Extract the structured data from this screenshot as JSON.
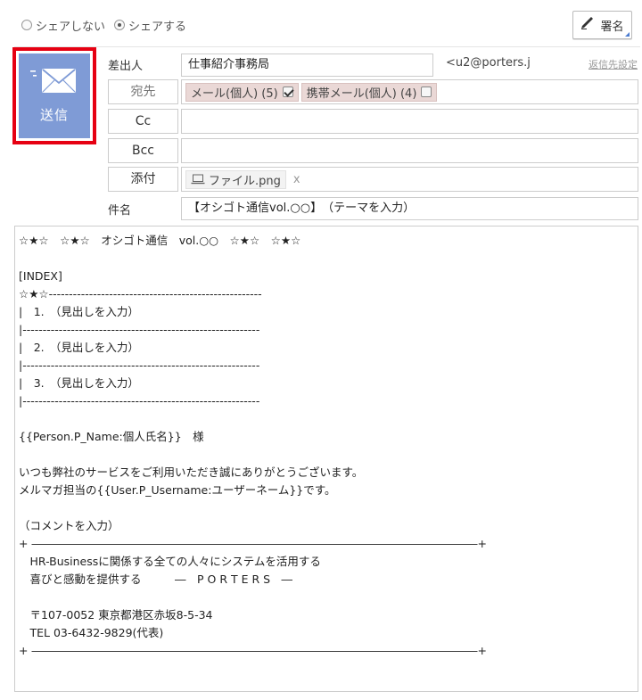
{
  "share": {
    "options": [
      "シェアしない",
      "シェアする"
    ],
    "selected_index": 1
  },
  "toolbar": {
    "signature_label": "署名",
    "signature_icon": "pen-icon"
  },
  "send": {
    "label": "送信",
    "icon": "envelope-icon",
    "bg": "#7f9bd6",
    "highlight": "#e60012"
  },
  "sender": {
    "label": "差出人",
    "value": "仕事紹介事務局",
    "address": "<u2@porters.j",
    "reply_link": "返信先設定"
  },
  "to": {
    "label": "宛先",
    "chips": [
      {
        "text": "メール(個人) (5)",
        "checked": true
      },
      {
        "text": "携帯メール(個人) (4)",
        "checked": false
      }
    ]
  },
  "cc": {
    "label": "Cc",
    "value": ""
  },
  "bcc": {
    "label": "Bcc",
    "value": ""
  },
  "attach": {
    "label": "添付",
    "file_name": "ファイル.png",
    "file_icon": "laptop-icon",
    "remove": "x"
  },
  "subject": {
    "label": "件名",
    "value": "【オシゴト通信vol.○○】　（テーマを入力）"
  },
  "body": {
    "lines": [
      "☆★☆　☆★☆　オシゴト通信　vol.○○　☆★☆　☆★☆",
      "",
      "[INDEX]",
      "☆★☆-----------------------------------------------------",
      "|　1.　（見出しを入力）",
      "|-----------------------------------------------------------",
      "|　2.　（見出しを入力）",
      "|-----------------------------------------------------------",
      "|　3.　（見出しを入力）",
      "|-----------------------------------------------------------",
      "",
      "{{Person.P_Name:個人氏名}}　様",
      "",
      "いつも弊社のサービスをご利用いただき誠にありがとうございます。",
      "メルマガ担当の{{User.P_Username:ユーザーネーム}}です。",
      "",
      "（コメントを入力）",
      "+ ――――――――――――――――――――――――――――――――――――――――+",
      "　HR-Businessに関係する全ての人々にシステムを活用する",
      "　喜びと感動を提供する　　　―　P O R T E R S　―",
      "",
      "　〒107-0052 東京都港区赤坂8-5-34",
      "　TEL 03-6432-9829(代表)",
      "+ ――――――――――――――――――――――――――――――――――――――――+"
    ]
  }
}
